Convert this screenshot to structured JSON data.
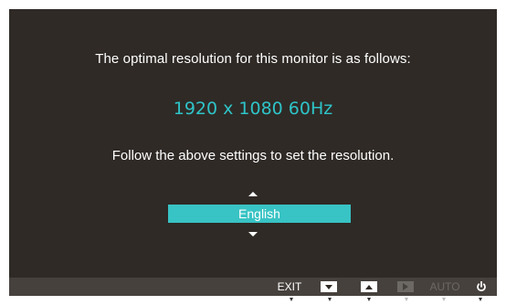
{
  "osd": {
    "message_top": "The optimal resolution for this monitor is as follows:",
    "resolution": "1920 x 1080 60Hz",
    "message_bottom": "Follow the above settings to set the resolution.",
    "language": {
      "selected": "English"
    }
  },
  "button_bar": {
    "exit_label": "EXIT",
    "auto_label": "AUTO",
    "icons": [
      "down-icon",
      "up-icon",
      "enter-icon",
      "power-icon"
    ]
  },
  "colors": {
    "osd_background": "#2f2a26",
    "accent": "#2ec4c8",
    "selection": "#38c3c4",
    "bar_background": "#46413d",
    "disabled": "#6c6864"
  }
}
